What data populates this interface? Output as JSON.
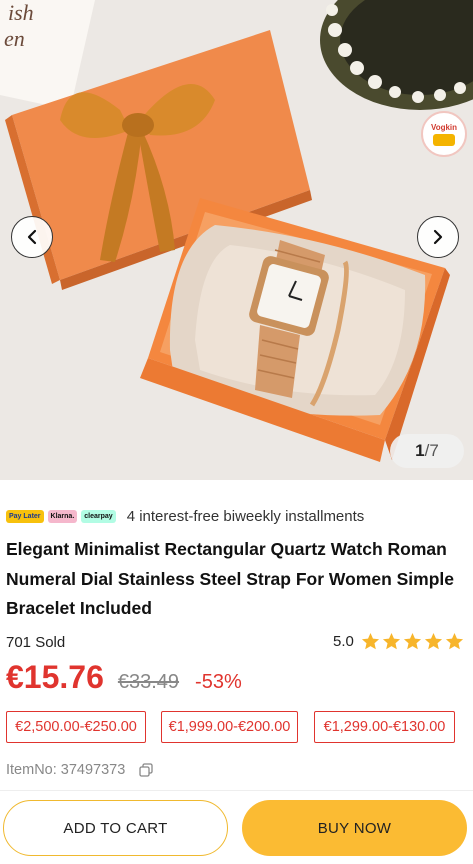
{
  "gallery": {
    "current": "1",
    "total": "/7",
    "badge_text": "Vogkin"
  },
  "payment": {
    "logos": [
      "Pay Later",
      "Klarna.",
      "clearpay"
    ],
    "text": "4 interest-free biweekly installments"
  },
  "product": {
    "title": "Elegant Minimalist Rectangular Quartz Watch Roman Numeral Dial Stainless Steel Strap For Women Simple Bracelet Included",
    "sold": "701 Sold",
    "rating": "5.0",
    "stars": 5,
    "price": "€15.76",
    "original_price": "€33.49",
    "discount": "-53%",
    "coupons": [
      "€2,500.00-€250.00",
      "€1,999.00-€200.00",
      "€1,299.00-€130.00"
    ],
    "item_no": "ItemNo: 37497373"
  },
  "actions": {
    "add_to_cart": "ADD TO CART",
    "buy_now": "BUY NOW"
  },
  "colors": {
    "accent_red": "#e0342e",
    "button_yellow": "#fbbb33",
    "star": "#f7b52b",
    "box_orange": "#f08a4b"
  }
}
